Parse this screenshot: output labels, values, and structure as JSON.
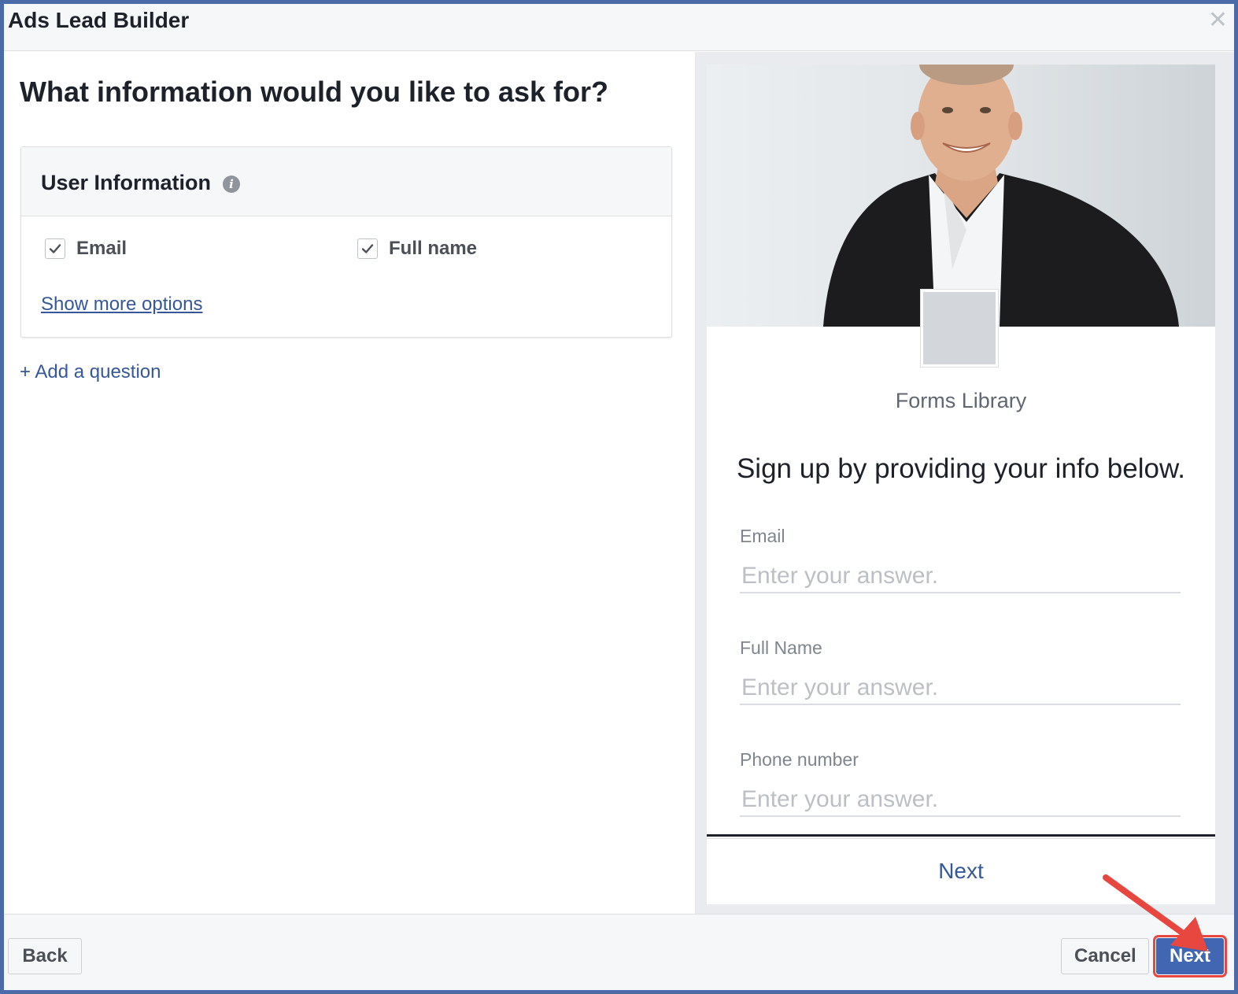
{
  "window": {
    "title": "Ads Lead Builder",
    "close_glyph": "✕"
  },
  "left": {
    "heading": "What information would you like to ask for?",
    "card": {
      "title": "User Information",
      "info_icon": "i",
      "options": [
        {
          "label": "Email",
          "checked": true
        },
        {
          "label": "Full name",
          "checked": true
        }
      ],
      "show_more": "Show more options"
    },
    "add_question": "+ Add a question"
  },
  "preview": {
    "page_name": "Forms Library",
    "headline": "Sign up by providing your info below.",
    "fields": [
      {
        "label": "Email",
        "placeholder": "Enter your answer."
      },
      {
        "label": "Full Name",
        "placeholder": "Enter your answer."
      },
      {
        "label": "Phone number",
        "placeholder": "Enter your answer."
      }
    ],
    "next_label": "Next"
  },
  "footer": {
    "back_label": "Back",
    "cancel_label": "Cancel",
    "next_label": "Next"
  },
  "colors": {
    "accent": "#4267b2",
    "link": "#365899",
    "highlight": "#e8473f",
    "dialog_border": "#4a6aa8"
  }
}
